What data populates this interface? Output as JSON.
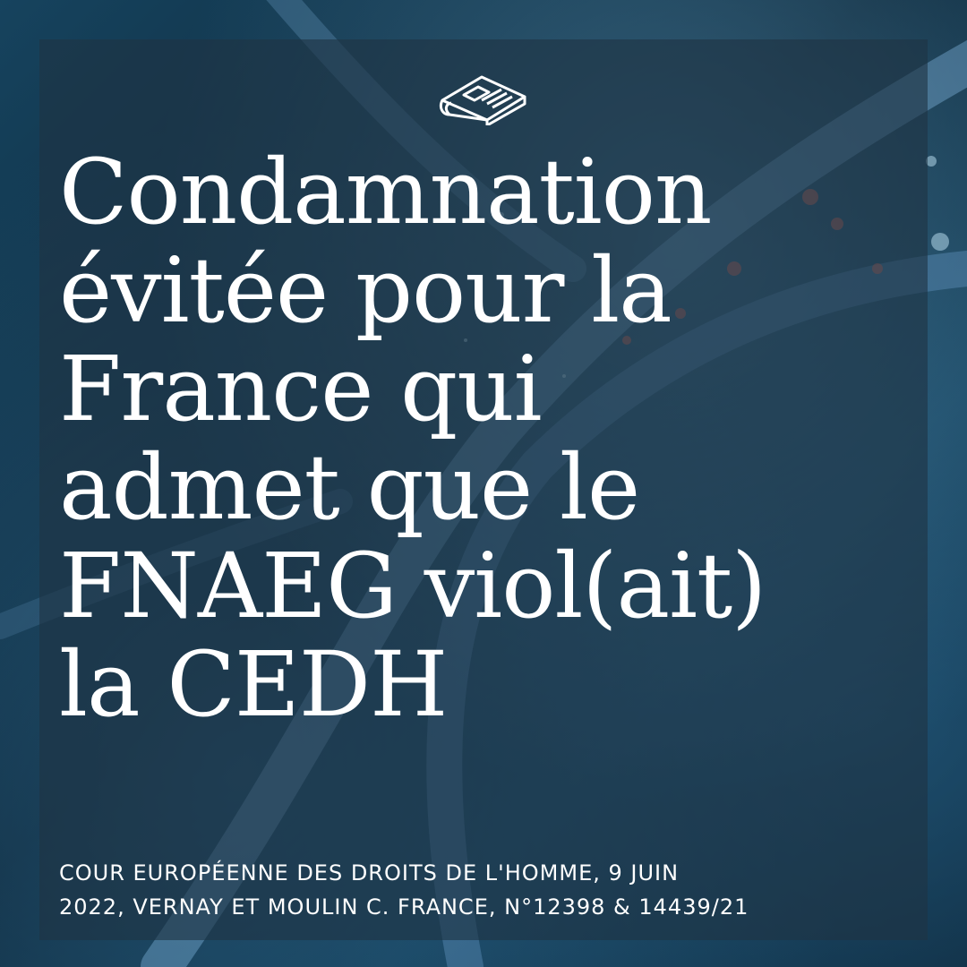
{
  "post": {
    "headline": "Condamnation\névitée pour la\nFrance qui\nadmet que le\nFNAEG viol(ait)\nla CEDH",
    "citation": "COUR EUROPÉENNE DES DROITS DE L'HOMME, 9 JUIN\n2022, VERNAY ET MOULIN C. FRANCE, N°12398 & 14439/21"
  },
  "icons": {
    "top": "newspaper-icon",
    "background": "dna-helix-image"
  },
  "colors": {
    "text": "#ffffff",
    "panel": "rgba(30, 52, 68, 0.62)",
    "background": "#0d2a3d",
    "accent_bokeh": "#e06a55"
  }
}
